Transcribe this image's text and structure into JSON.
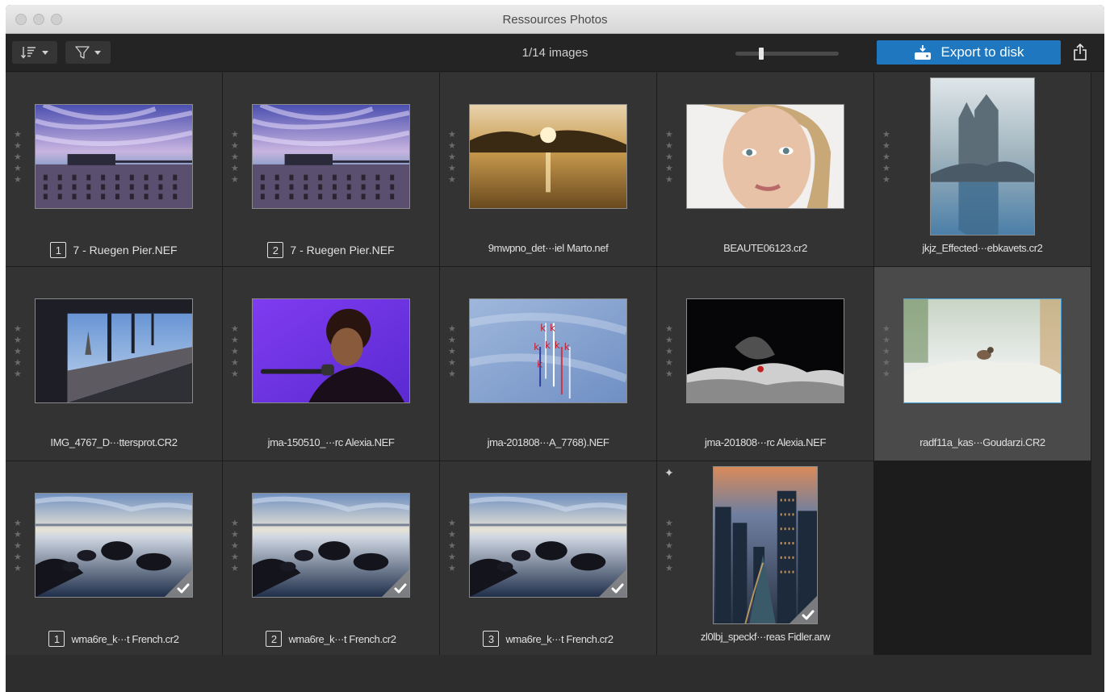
{
  "window": {
    "title": "Ressources Photos"
  },
  "toolbar": {
    "sort_icon": "sort-lines-icon",
    "filter_icon": "funnel-icon",
    "image_count": "1/14 images",
    "zoom_slider_value": 0.25,
    "export_label": "Export to disk",
    "export_icon": "disk-export-icon",
    "share_icon": "share-icon"
  },
  "images": [
    {
      "filename": "7 - Ruegen Pier.NEF",
      "badge": "1",
      "stars": 0,
      "checked": false,
      "selected": false,
      "thumb": "pier"
    },
    {
      "filename": "7 - Ruegen Pier.NEF",
      "badge": "2",
      "stars": 0,
      "checked": false,
      "selected": false,
      "thumb": "pier"
    },
    {
      "filename": "9mwpno_det···iel Marto.nef",
      "badge": "",
      "stars": 0,
      "checked": false,
      "selected": false,
      "thumb": "sunrise"
    },
    {
      "filename": "BEAUTE06123.cr2",
      "badge": "",
      "stars": 0,
      "checked": false,
      "selected": false,
      "thumb": "portrait"
    },
    {
      "filename": "jkjz_Effected···ebkavets.cr2",
      "badge": "",
      "stars": 0,
      "checked": false,
      "selected": false,
      "thumb": "castle"
    },
    {
      "filename": "IMG_4767_D···ttersprot.CR2",
      "badge": "",
      "stars": 0,
      "checked": false,
      "selected": false,
      "thumb": "bridge"
    },
    {
      "filename": "jma-150510_···rc Alexia.NEF",
      "badge": "",
      "stars": 0,
      "checked": false,
      "selected": false,
      "thumb": "singer"
    },
    {
      "filename": "jma-201808···A_7768).NEF",
      "badge": "",
      "stars": 0,
      "checked": false,
      "selected": false,
      "thumb": "jets"
    },
    {
      "filename": "jma-201808···rc Alexia.NEF",
      "badge": "",
      "stars": 0,
      "checked": false,
      "selected": false,
      "thumb": "surf"
    },
    {
      "filename": "radf11a_kas···Goudarzi.CR2",
      "badge": "",
      "stars": 0,
      "checked": false,
      "selected": true,
      "thumb": "bird"
    },
    {
      "filename": "wma6re_k···t French.cr2",
      "badge": "1",
      "stars": 0,
      "checked": true,
      "selected": false,
      "thumb": "lake"
    },
    {
      "filename": "wma6re_k···t French.cr2",
      "badge": "2",
      "stars": 0,
      "checked": true,
      "selected": false,
      "thumb": "lake"
    },
    {
      "filename": "wma6re_k···t French.cr2",
      "badge": "3",
      "stars": 0,
      "checked": true,
      "selected": false,
      "thumb": "lake"
    },
    {
      "filename": "zl0lbj_speckf···reas Fidler.arw",
      "badge": "",
      "stars": 0,
      "checked": true,
      "selected": false,
      "sparkle": true,
      "thumb": "city"
    }
  ],
  "colors": {
    "window_bg": "#2d2d2d",
    "toolbar_bg": "#242424",
    "cell_bg": "#333333",
    "selected_cell_bg": "#4a4a4a",
    "accent": "#1f78bf",
    "text": "#e0e0e0"
  }
}
